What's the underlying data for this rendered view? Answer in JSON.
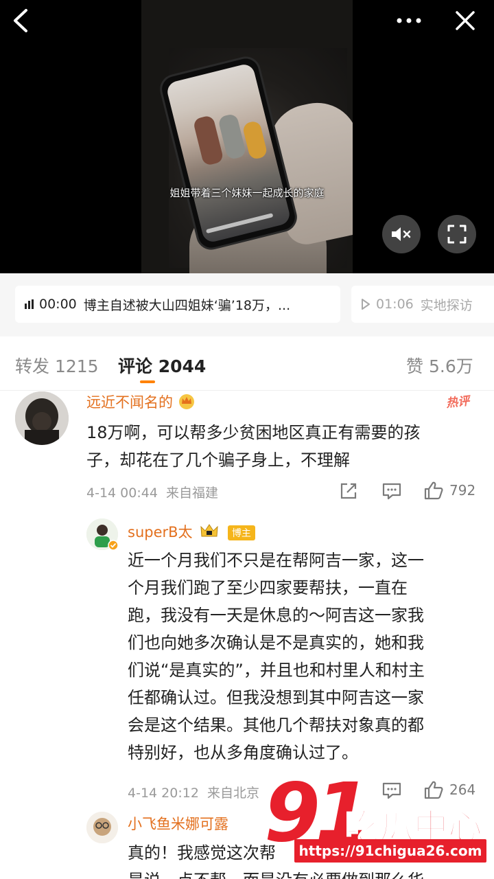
{
  "video": {
    "caption": "姐姐带着三个妹妹一起成长的家庭",
    "icons": {
      "back": "back-chevron-icon",
      "more": "more-dots-icon",
      "close": "close-icon",
      "mute": "mute-speaker-icon",
      "fullscreen": "fullscreen-icon"
    }
  },
  "playlist": {
    "items": [
      {
        "time": "00:00",
        "title": "博主自述被大山四姐妹‘骗’18万，...",
        "active": true
      },
      {
        "time": "01:06",
        "title": "实地探访",
        "active": false
      }
    ]
  },
  "tabs": [
    {
      "label": "转发",
      "count": "1215",
      "active": false
    },
    {
      "label": "评论",
      "count": "2044",
      "active": true
    },
    {
      "label": "赞",
      "count": "5.6万",
      "active": false
    }
  ],
  "comments": [
    {
      "author": "远近不闻名的",
      "tag": "热评",
      "text": "18万啊，可以帮多少贫困地区真正有需要的孩子，却花在了几个骗子身上，不理解",
      "text_lines": [
        "18万啊，可以帮多少贫困地区真正有需要的孩",
        "子，却花在了几个骗子身上，不理解"
      ],
      "time": "4-14 00:44",
      "location": "来自福建",
      "likes": "792"
    },
    {
      "author": "superB太",
      "badge": "博主",
      "text_lines": [
        "近一个月我们不只是在帮阿吉一家，这一",
        "个月我们跑了至少四家要帮扶，一直在",
        "跑，我没有一天是休息的～阿吉这一家我",
        "们也向她多次确认是不是真实的，她和我",
        "们说“是真实的”，并且也和村里人和村主",
        "任都确认过。但我没想到其中阿吉这一家",
        "会是这个结果。其他几个帮扶对象真的都",
        "特别好，也从多角度确认过了。"
      ],
      "time": "4-14 20:12",
      "location": "来自北京",
      "likes": "264"
    },
    {
      "author": "小飞鱼米娜可露",
      "text_lines": [
        "真的！我感觉这次帮",
        "是说一点不帮，而是没有必要做到那么华"
      ]
    }
  ],
  "watermark": {
    "big": "91",
    "cn": "吃瓜中心",
    "url": "https://91chigua26.com"
  },
  "colors": {
    "accent": "#ff8200",
    "name": "#e3701e",
    "hot": "#f26b5b",
    "watermark": "#e7202c"
  }
}
